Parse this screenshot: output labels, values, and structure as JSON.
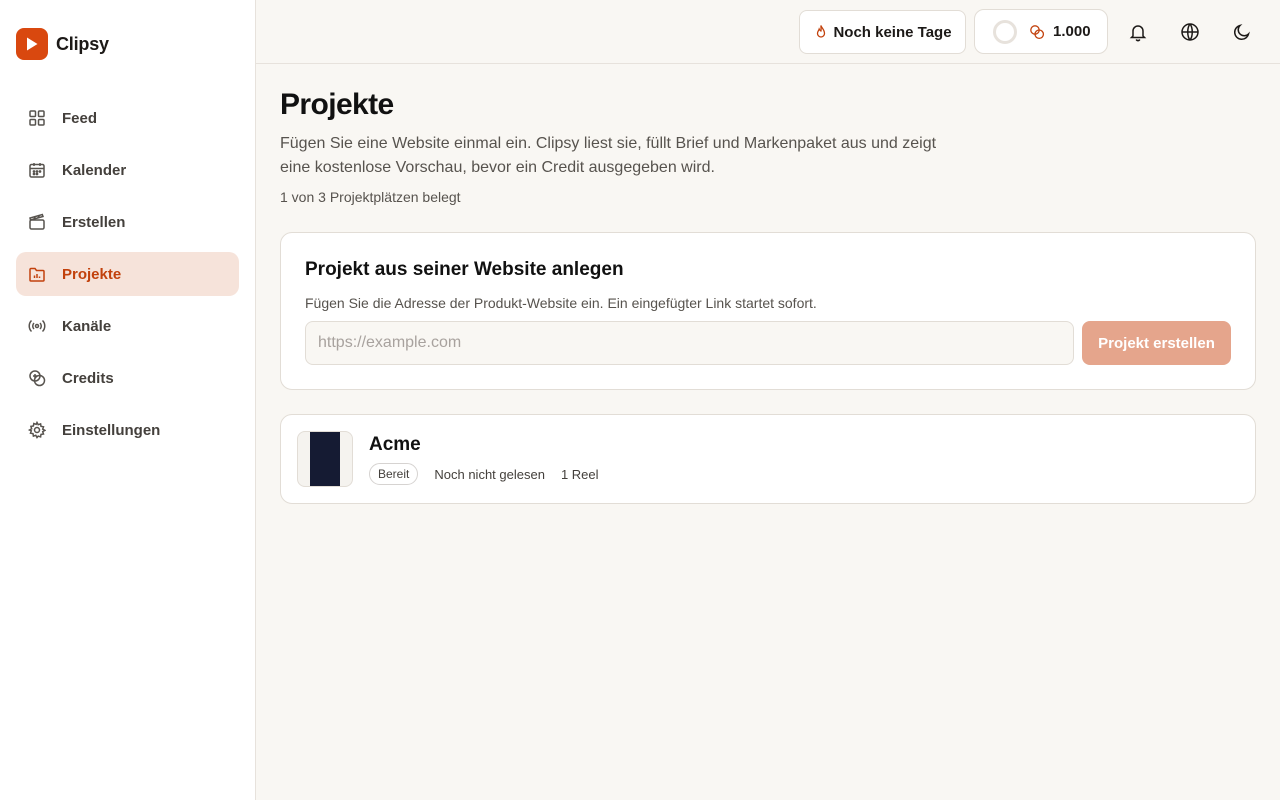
{
  "app": {
    "name": "Clipsy",
    "logo_icon": "play-icon",
    "brand_color": "#d9480f"
  },
  "sidebar": {
    "items": [
      {
        "label": "Feed",
        "icon": "grid-icon",
        "active": false
      },
      {
        "label": "Kalender",
        "icon": "calendar-icon",
        "active": false
      },
      {
        "label": "Erstellen",
        "icon": "clapperboard-icon",
        "active": false
      },
      {
        "label": "Projekte",
        "icon": "folder-chart-icon",
        "active": true
      },
      {
        "label": "Kanäle",
        "icon": "broadcast-icon",
        "active": false
      },
      {
        "label": "Credits",
        "icon": "coins-icon",
        "active": false
      },
      {
        "label": "Einstellungen",
        "icon": "gear-icon",
        "active": false
      }
    ]
  },
  "topbar": {
    "streak_label": "Noch keine Tage",
    "streak_icon": "flame-icon",
    "credits_value": "1.000",
    "credits_icon": "coins-icon",
    "icons": [
      "bell-icon",
      "globe-icon",
      "moon-icon"
    ]
  },
  "page": {
    "title": "Projekte",
    "description": "Fügen Sie eine Website einmal ein. Clipsy liest sie, füllt Brief und Markenpaket aus und zeigt eine kostenlose Vorschau, bevor ein Credit ausgegeben wird.",
    "slots": "1 von 3 Projektplätzen belegt"
  },
  "create": {
    "title": "Projekt aus seiner Website anlegen",
    "subtitle": "Fügen Sie die Adresse der Produkt-Website ein. Ein eingefügter Link startet sofort.",
    "placeholder": "https://example.com",
    "value": "",
    "button_label": "Projekt erstellen"
  },
  "projects": [
    {
      "name": "Acme",
      "status": "Bereit",
      "read_state": "Noch nicht gelesen",
      "reels": "1 Reel"
    }
  ],
  "colors": {
    "accent": "#c2410c",
    "active_bg": "#f6e3da",
    "button_disabled": "#e5a58c",
    "thumb": "#151b33"
  }
}
